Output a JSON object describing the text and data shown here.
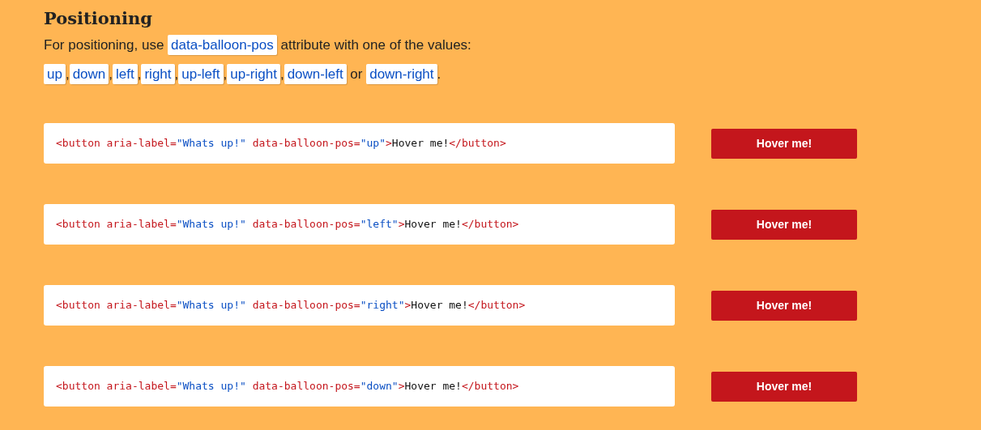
{
  "heading": "Positioning",
  "intro": [
    {
      "kind": "text",
      "text": "For positioning, use"
    },
    {
      "kind": "code",
      "text": "data-balloon-pos"
    },
    {
      "kind": "text",
      "text": "attribute with one of the values:"
    }
  ],
  "values": [
    {
      "kind": "code",
      "text": "up"
    },
    {
      "kind": "text",
      "text": ","
    },
    {
      "kind": "code",
      "text": "down"
    },
    {
      "kind": "text",
      "text": ","
    },
    {
      "kind": "code",
      "text": "left"
    },
    {
      "kind": "text",
      "text": ","
    },
    {
      "kind": "code",
      "text": "right"
    },
    {
      "kind": "text",
      "text": ","
    },
    {
      "kind": "code",
      "text": "up-left"
    },
    {
      "kind": "text",
      "text": ","
    },
    {
      "kind": "code",
      "text": "up-right"
    },
    {
      "kind": "text",
      "text": ","
    },
    {
      "kind": "code",
      "text": "down-left"
    },
    {
      "kind": "text",
      "text": " or "
    },
    {
      "kind": "code",
      "text": "down-right"
    },
    {
      "kind": "text",
      "text": "."
    }
  ],
  "examples": [
    {
      "code": [
        {
          "kind": "tag",
          "text": "<button aria-label="
        },
        {
          "kind": "string",
          "text": "\"Whats up!\""
        },
        {
          "kind": "tag",
          "text": " data-balloon-pos="
        },
        {
          "kind": "string",
          "text": "\"up\""
        },
        {
          "kind": "tag",
          "text": ">"
        },
        {
          "kind": "text",
          "text": "Hover me!"
        },
        {
          "kind": "tag",
          "text": "</button>"
        }
      ],
      "button": "Hover me!"
    },
    {
      "code": [
        {
          "kind": "tag",
          "text": "<button aria-label="
        },
        {
          "kind": "string",
          "text": "\"Whats up!\""
        },
        {
          "kind": "tag",
          "text": " data-balloon-pos="
        },
        {
          "kind": "string",
          "text": "\"left\""
        },
        {
          "kind": "tag",
          "text": ">"
        },
        {
          "kind": "text",
          "text": "Hover me!"
        },
        {
          "kind": "tag",
          "text": "</button>"
        }
      ],
      "button": "Hover me!"
    },
    {
      "code": [
        {
          "kind": "tag",
          "text": "<button aria-label="
        },
        {
          "kind": "string",
          "text": "\"Whats up!\""
        },
        {
          "kind": "tag",
          "text": " data-balloon-pos="
        },
        {
          "kind": "string",
          "text": "\"right\""
        },
        {
          "kind": "tag",
          "text": ">"
        },
        {
          "kind": "text",
          "text": "Hover me!"
        },
        {
          "kind": "tag",
          "text": "</button>"
        }
      ],
      "button": "Hover me!"
    },
    {
      "code": [
        {
          "kind": "tag",
          "text": "<button aria-label="
        },
        {
          "kind": "string",
          "text": "\"Whats up!\""
        },
        {
          "kind": "tag",
          "text": " data-balloon-pos="
        },
        {
          "kind": "string",
          "text": "\"down\""
        },
        {
          "kind": "tag",
          "text": ">"
        },
        {
          "kind": "text",
          "text": "Hover me!"
        },
        {
          "kind": "tag",
          "text": "</button>"
        }
      ],
      "button": "Hover me!"
    }
  ]
}
